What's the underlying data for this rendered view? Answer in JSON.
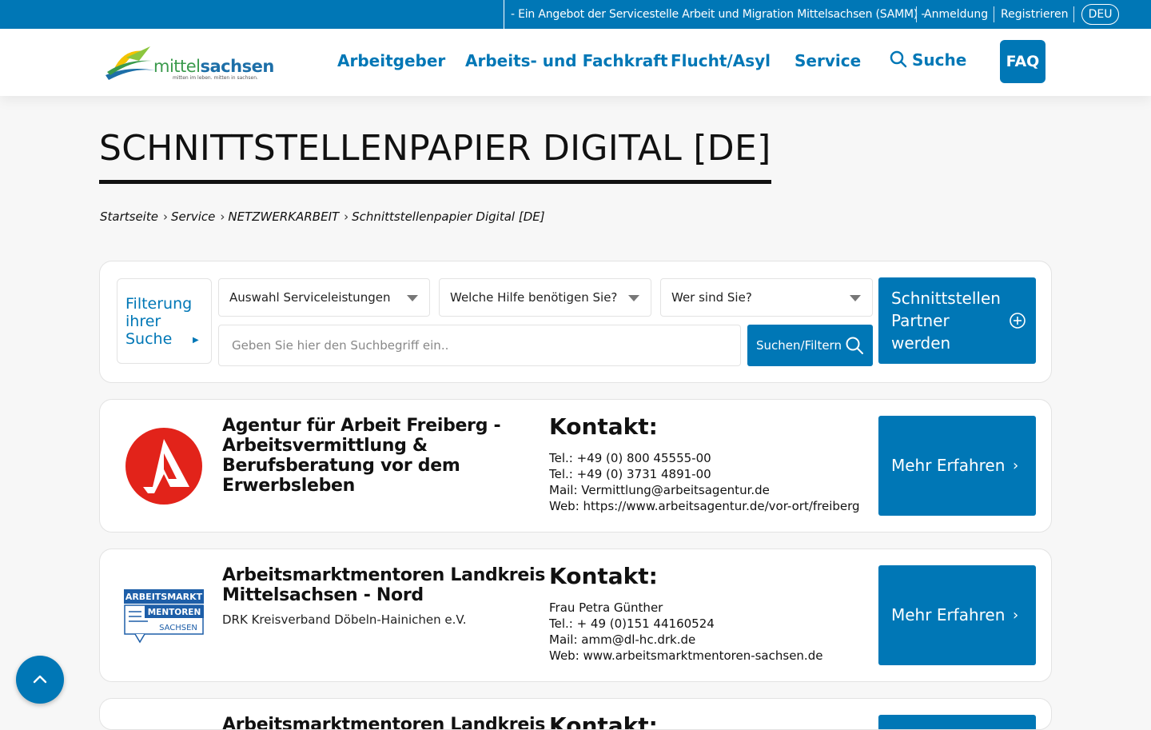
{
  "topbar": {
    "offer_text": "- Ein Angebot der Servicestelle Arbeit und Migration Mittelsachsen (SAMM) -",
    "login": "Anmeldung",
    "register": "Registrieren",
    "language": "DEU"
  },
  "header": {
    "logo_word_a": "mittel",
    "logo_word_b": "sachsen",
    "logo_tagline": "mitten im leben. mitten in sachsen.",
    "nav": [
      "Arbeitgeber",
      "Arbeits- und Fachkraft",
      "Flucht/Asyl",
      "Service"
    ],
    "search_label": "Suche",
    "faq_label": "FAQ"
  },
  "page": {
    "title": "SCHNITTSTELLENPAPIER DIGITAL [DE]",
    "breadcrumb": [
      "Startseite",
      "Service",
      "NETZWERKARBEIT",
      "Schnittstellenpapier Digital [DE]"
    ]
  },
  "filter": {
    "label": "Filterung ihrer Suche",
    "select_services": "Auswahl Serviceleistungen",
    "select_help": "Welche Hilfe benötigen Sie?",
    "select_who": "Wer sind Sie?",
    "search_placeholder": "Geben Sie hier den Suchbegriff ein..",
    "search_value": "",
    "search_button": "Suchen/Filtern",
    "partner_button": "Schnittstellen Partner werden"
  },
  "results": [
    {
      "title": "Agentur für Arbeit Freiberg - Arbeitsvermittlung & Berufsberatung vor dem Erwerbsleben",
      "subtitle": "",
      "contact_heading": "Kontakt:",
      "contact_lines": [
        "Tel.: +49 (0) 800 45555-00",
        "Tel.: +49 (0) 3731 4891-00",
        "Mail: Vermittlung@arbeitsagentur.de",
        "Web: https://www.arbeitsagentur.de/vor-ort/freiberg"
      ],
      "button": "Mehr Erfahren"
    },
    {
      "title": "Arbeitsmarktmentoren Landkreis Mittelsachsen - Nord",
      "subtitle": "DRK Kreisverband Döbeln-Hainichen e.V.",
      "contact_heading": "Kontakt:",
      "contact_lines": [
        "Frau Petra Günther",
        "Tel.: + 49 (0)151 44160524",
        "Mail: amm@dl-hc.drk.de",
        "Web: www.arbeitsmarktmentoren-sachsen.de"
      ],
      "button": "Mehr Erfahren",
      "logo_text": [
        "ARBEITSMARKT",
        "MENTOREN",
        "SACHSEN"
      ]
    },
    {
      "title": "Arbeitsmarktmentoren Landkreis",
      "contact_heading": "Kontakt:"
    }
  ],
  "colors": {
    "brand_blue": "#0077b6",
    "ba_red": "#e2231a"
  }
}
